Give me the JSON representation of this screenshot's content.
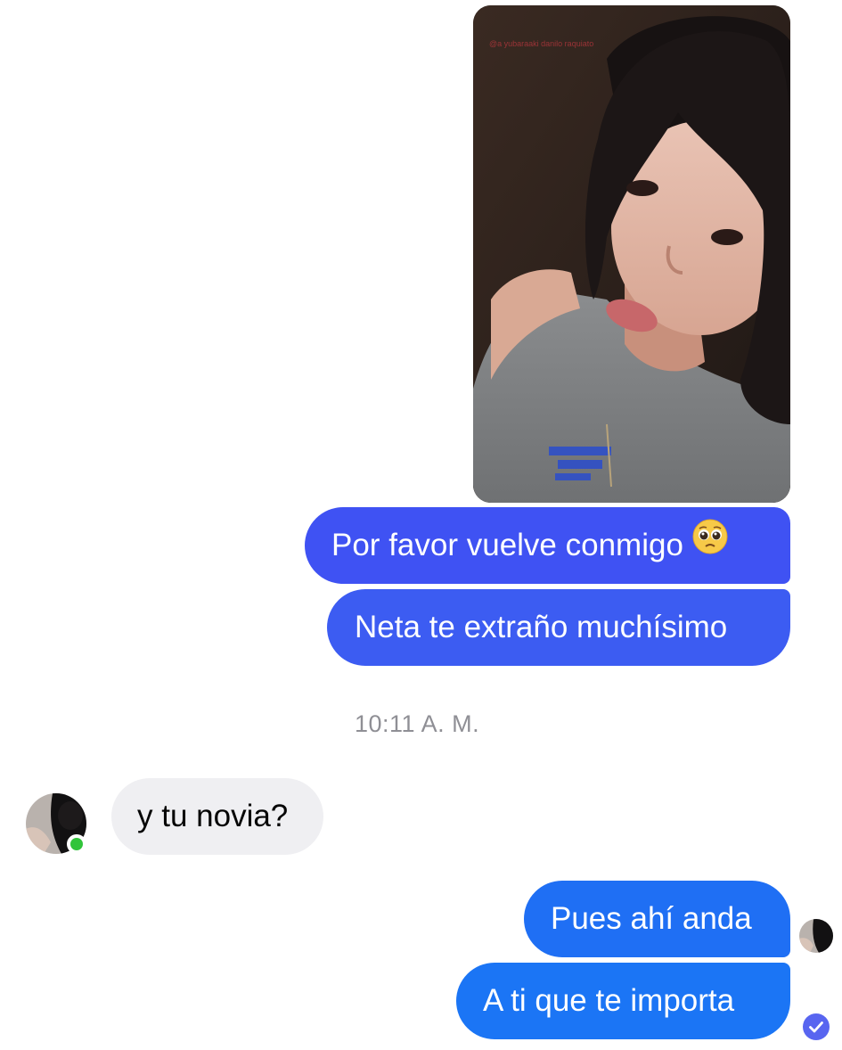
{
  "conversation": {
    "outgoing_photo": {
      "icon": "selfie-photo",
      "watermark": "@a yubaraaki danilo raquiato"
    },
    "messages": [
      {
        "direction": "outgoing",
        "text": "Por favor vuelve conmigo",
        "emoji": "pleading-face-emoji"
      },
      {
        "direction": "outgoing",
        "text": "Neta te extraño muchísimo"
      },
      {
        "direction": "incoming",
        "text": "y tu novia?"
      },
      {
        "direction": "outgoing",
        "text": "Pues ahí anda"
      },
      {
        "direction": "outgoing",
        "text": "A ti que te importa"
      }
    ],
    "timestamp": "10:11 A. M.",
    "status": {
      "contact_online": true,
      "read_receipt": "seen-avatar",
      "sent_indicator": "check-circle-icon"
    },
    "colors": {
      "outgoing_bubble_top": "#3f52f3",
      "outgoing_bubble_bottom": "#1b75f5",
      "incoming_bubble": "#efeff2",
      "online_dot": "#31c43a"
    }
  }
}
